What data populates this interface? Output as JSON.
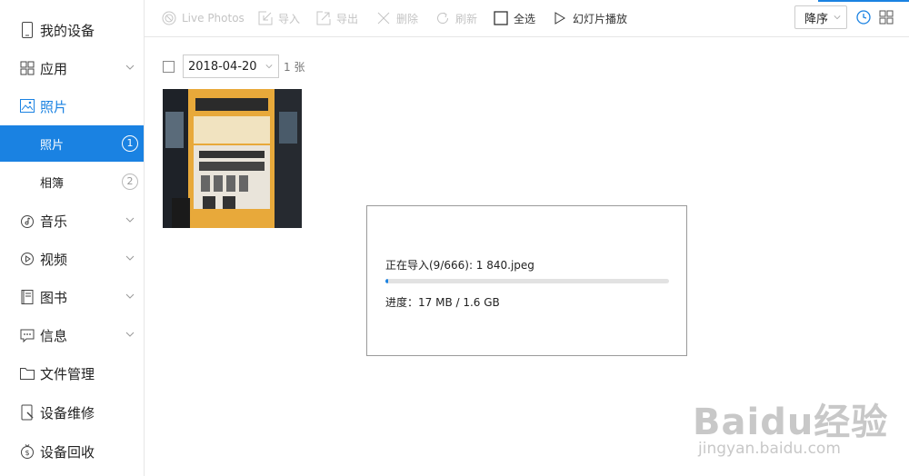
{
  "sidebar": {
    "my_device": "我的设备",
    "apps": "应用",
    "photos": "照片",
    "photos_sub": [
      {
        "label": "照片",
        "badge": "1"
      },
      {
        "label": "相簿",
        "badge": "2"
      }
    ],
    "music": "音乐",
    "video": "视频",
    "books": "图书",
    "messages": "信息",
    "file_manager": "文件管理",
    "device_repair": "设备维修",
    "device_recycle": "设备回收"
  },
  "toolbar": {
    "live_photos": "Live Photos",
    "import": "导入",
    "export": "导出",
    "delete": "删除",
    "refresh": "刷新",
    "select_all": "全选",
    "slideshow": "幻灯片播放",
    "sort_value": "降序"
  },
  "content": {
    "date": "2018-04-20",
    "count": "1 张"
  },
  "dialog": {
    "status": "正在导入(9/666): 1 840.jpeg",
    "progress_text": "进度：17 MB / 1.6 GB",
    "progress_fraction": 0.011
  },
  "watermark": {
    "brand": "Baidu经验",
    "url": "jingyan.baidu.com"
  },
  "colors": {
    "accent": "#1a82e2"
  }
}
